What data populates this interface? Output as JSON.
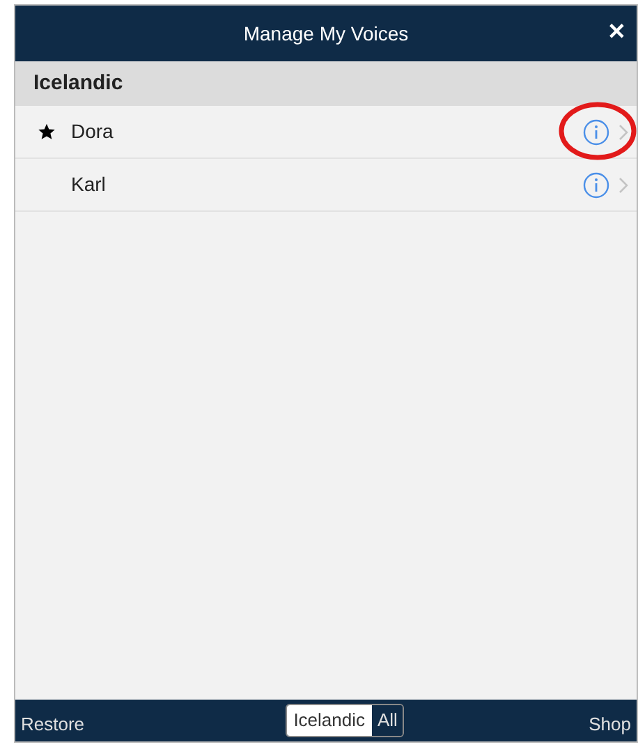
{
  "window": {
    "title": "Manage My Voices",
    "close": "✕"
  },
  "section": {
    "title": "Icelandic"
  },
  "voices": [
    {
      "name": "Dora",
      "favorite": true,
      "highlighted": true
    },
    {
      "name": "Karl",
      "favorite": false,
      "highlighted": false
    }
  ],
  "footer": {
    "restore": "Restore",
    "segments": [
      {
        "label": "Icelandic",
        "selected": true
      },
      {
        "label": "All",
        "selected": false
      }
    ],
    "shop": "Shop"
  }
}
